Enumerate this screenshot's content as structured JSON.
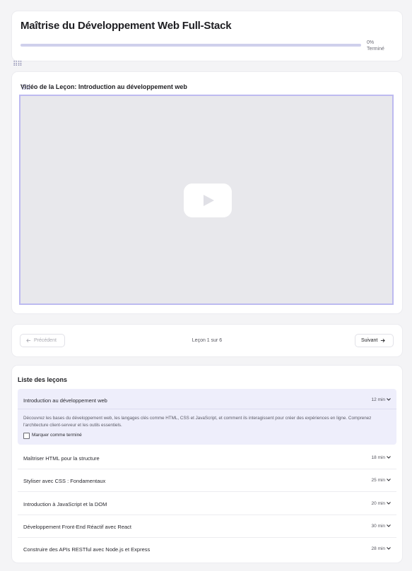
{
  "course": {
    "title": "Maîtrise du Développement Web Full-Stack",
    "progress_percent": 0,
    "progress_label": "0%",
    "progress_status": "Terminé"
  },
  "video": {
    "heading": "Vidéo de la Leçon: Introduction au développement web",
    "play_icon": "play-icon"
  },
  "navigation": {
    "previous_label": "Précédent",
    "next_label": "Suivant",
    "counter": "Leçon 1 sur 6"
  },
  "lessons": {
    "heading": "Liste des leçons",
    "items": [
      {
        "title": "Introduction au développement web",
        "duration": "12 min",
        "expanded": true,
        "description": "Découvrez les bases du développement web, les langages clés comme HTML, CSS et JavaScript, et comment ils interagissent pour créer des expériences en ligne. Comprenez l'architecture client-serveur et les outils essentiels.",
        "mark_complete_label": "Marquer comme terminé"
      },
      {
        "title": "Maîtriser HTML pour la structure",
        "duration": "18 min"
      },
      {
        "title": "Styliser avec CSS : Fondamentaux",
        "duration": "25 min"
      },
      {
        "title": "Introduction à JavaScript et la DOM",
        "duration": "20 min"
      },
      {
        "title": "Développement Front-End Réactif avec React",
        "duration": "30 min"
      },
      {
        "title": "Construire des APIs RESTful avec Node.js et Express",
        "duration": "28 min"
      }
    ]
  },
  "colors": {
    "accent": "#6b67d9",
    "progress_track": "#cfd0ec",
    "active_lesson_bg": "#eeeefb",
    "video_border": "#bdbaf0"
  }
}
